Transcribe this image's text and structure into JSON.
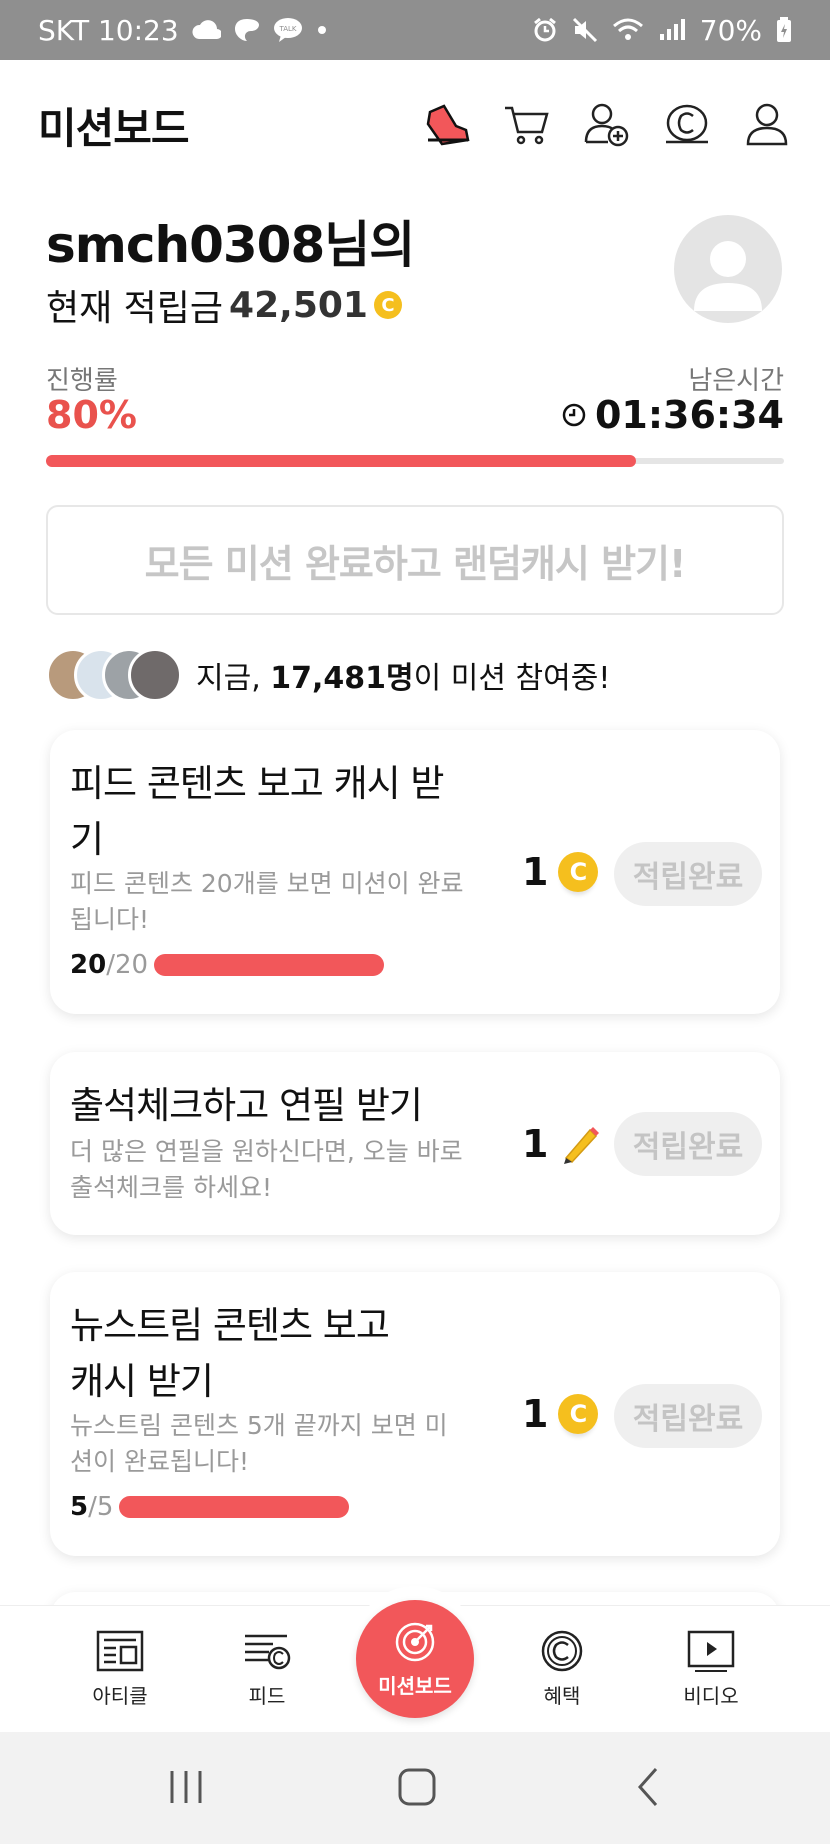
{
  "status_bar": {
    "carrier_time": "SKT 10:23",
    "battery": "70%",
    "icons": [
      "cloud-icon",
      "app-icon",
      "talk-icon",
      "dot-icon",
      "alarm-icon",
      "mute-icon",
      "wifi-icon",
      "signal-icon",
      "battery-icon"
    ]
  },
  "header": {
    "title": "미션보드",
    "icons": [
      "shoe-icon",
      "cart-icon",
      "add-friend-icon",
      "cash-icon",
      "profile-icon"
    ]
  },
  "user": {
    "name": "smch0308님의",
    "balance_label": "현재 적립금",
    "balance_value": "42,501",
    "coin_symbol": "C"
  },
  "progress": {
    "label": "진행률",
    "value": "80%",
    "fraction": 0.8,
    "time_label": "남은시간",
    "time_value": "01:36:34"
  },
  "all_missions_button": "모든 미션 완료하고 랜덤캐시 받기!",
  "participants": {
    "prefix": "지금, ",
    "count": "17,481명",
    "suffix": "이 미션 참여중!"
  },
  "missions": [
    {
      "title": "피드 콘텐츠 보고 캐시 받기",
      "description": "피드 콘텐츠 20개를 보면 미션이 완료됩니다!",
      "progress_done": "20",
      "progress_total": "/20",
      "progress_fraction": 1.0,
      "reward_amount": "1",
      "reward_icon": "coin-icon",
      "button": "적립완료"
    },
    {
      "title": "출석체크하고 연필 받기",
      "description": "더 많은 연필을 원하신다면, 오늘 바로 출석체크를 하세요!",
      "reward_amount": "1",
      "reward_icon": "pencil-icon",
      "button": "적립완료"
    },
    {
      "title": "뉴스트림 콘텐츠 보고 캐시 받기",
      "description": "뉴스트림 콘텐츠 5개 끝까지 보면 미션이 완료됩니다!",
      "progress_done": "5",
      "progress_total": "/5",
      "progress_fraction": 1.0,
      "reward_amount": "1",
      "reward_icon": "coin-icon",
      "button": "적립완료"
    }
  ],
  "bottom_nav": {
    "items": [
      "아티클",
      "피드",
      "미션보드",
      "혜택",
      "비디오"
    ]
  },
  "colors": {
    "accent": "#f2575a",
    "coin": "#f5bf1e"
  }
}
